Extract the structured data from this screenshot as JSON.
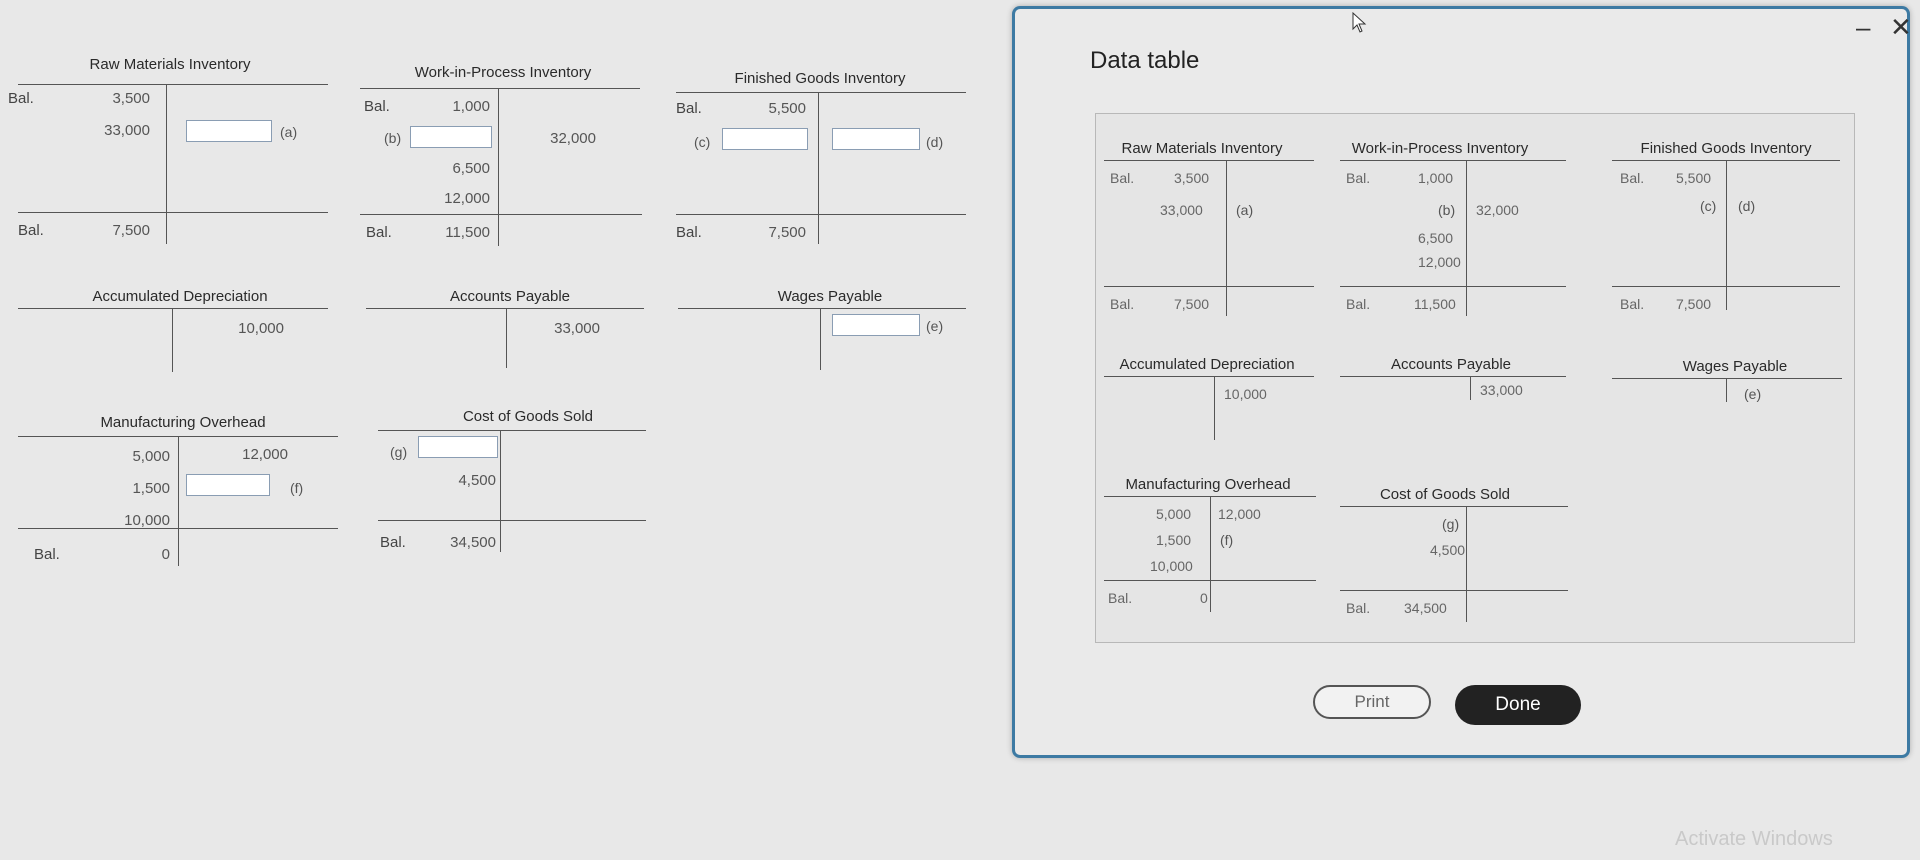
{
  "accounts": {
    "raw_materials": {
      "title": "Raw Materials Inventory",
      "bal_label": "Bal.",
      "beg": "3,500",
      "debit2": "33,000",
      "tag": "(a)",
      "end_label": "Bal.",
      "end": "7,500"
    },
    "wip": {
      "title": "Work-in-Process Inventory",
      "bal_label": "Bal.",
      "beg": "1,000",
      "tag_b": "(b)",
      "credit": "32,000",
      "d2": "6,500",
      "d3": "12,000",
      "end_label": "Bal.",
      "end": "11,500"
    },
    "finished": {
      "title": "Finished Goods Inventory",
      "bal_label": "Bal.",
      "beg": "5,500",
      "tag_c": "(c)",
      "tag_d": "(d)",
      "end_label": "Bal.",
      "end": "7,500"
    },
    "accum_dep": {
      "title": "Accumulated Depreciation",
      "credit": "10,000"
    },
    "accounts_payable": {
      "title": "Accounts Payable",
      "credit": "33,000"
    },
    "wages_payable": {
      "title": "Wages Payable",
      "tag": "(e)"
    },
    "mfg_overhead": {
      "title": "Manufacturing Overhead",
      "d1": "5,000",
      "c1": "12,000",
      "d2": "1,500",
      "tag": "(f)",
      "d3": "10,000",
      "end_label": "Bal.",
      "end": "0"
    },
    "cogs": {
      "title": "Cost of Goods Sold",
      "tag": "(g)",
      "d2": "4,500",
      "end_label": "Bal.",
      "end": "34,500"
    }
  },
  "modal": {
    "title": "Data table",
    "rm": {
      "title": "Raw Materials Inventory",
      "bal": "Bal.",
      "beg": "3,500",
      "d2": "33,000",
      "tag": "(a)",
      "end_label": "Bal.",
      "end": "7,500"
    },
    "wip": {
      "title": "Work-in-Process Inventory",
      "bal": "Bal.",
      "beg": "1,000",
      "tag": "(b)",
      "credit": "32,000",
      "d2": "6,500",
      "d3": "12,000",
      "end_label": "Bal.",
      "end": "11,500"
    },
    "fg": {
      "title": "Finished Goods Inventory",
      "bal": "Bal.",
      "beg": "5,500",
      "tag_c": "(c)",
      "tag_d": "(d)",
      "end_label": "Bal.",
      "end": "7,500"
    },
    "ad": {
      "title": "Accumulated Depreciation",
      "credit": "10,000"
    },
    "ap": {
      "title": "Accounts Payable",
      "credit": "33,000"
    },
    "wp": {
      "title": "Wages Payable",
      "tag": "(e)"
    },
    "mo": {
      "title": "Manufacturing Overhead",
      "d1": "5,000",
      "c1": "12,000",
      "d2": "1,500",
      "tag": "(f)",
      "d3": "10,000",
      "end_label": "Bal.",
      "end": "0"
    },
    "cogs": {
      "title": "Cost of Goods Sold",
      "tag": "(g)",
      "d2": "4,500",
      "end_label": "Bal.",
      "end": "34,500"
    },
    "print_label": "Print",
    "done_label": "Done"
  },
  "window": {
    "minimize": "–",
    "close": "✕"
  },
  "watermark": "Activate Windows",
  "colors": {
    "modal_border": "#3d7aa3",
    "done_bg": "#222222",
    "input_border": "#8a9db3"
  }
}
